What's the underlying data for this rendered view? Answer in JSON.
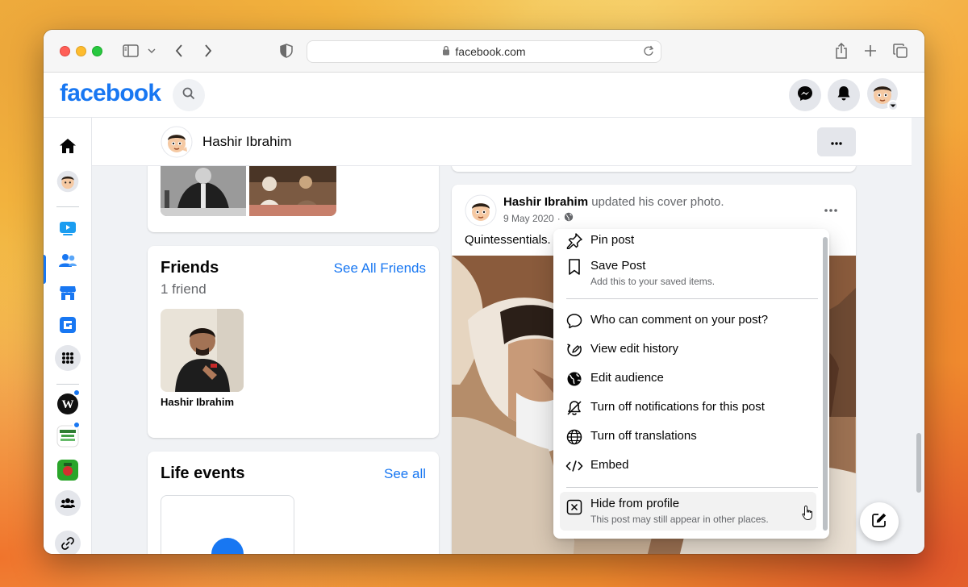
{
  "browser": {
    "url": "facebook.com"
  },
  "header": {
    "logo": "facebook"
  },
  "profile_bar": {
    "name": "Hashir Ibrahim"
  },
  "friends": {
    "title": "Friends",
    "see_all": "See All Friends",
    "count": "1 friend",
    "items": [
      {
        "name": "Hashir Ibrahim"
      }
    ]
  },
  "life_events": {
    "title": "Life events",
    "see_all": "See all"
  },
  "post": {
    "author": "Hashir Ibrahim",
    "action": "updated his cover photo.",
    "date": "9 May 2020",
    "separator": "·",
    "caption": "Quintessentials."
  },
  "menu": {
    "items": [
      {
        "label": "Pin post",
        "sub": "",
        "icon": "pin-icon"
      },
      {
        "label": "Save Post",
        "sub": "Add this to your saved items.",
        "icon": "bookmark-icon"
      },
      {
        "label": "Who can comment on your post?",
        "sub": "",
        "icon": "comment-icon"
      },
      {
        "label": "View edit history",
        "sub": "",
        "icon": "history-icon"
      },
      {
        "label": "Edit audience",
        "sub": "",
        "icon": "globe-icon"
      },
      {
        "label": "Turn off notifications for this post",
        "sub": "",
        "icon": "bell-off-icon"
      },
      {
        "label": "Turn off translations",
        "sub": "",
        "icon": "translate-icon"
      },
      {
        "label": "Embed",
        "sub": "",
        "icon": "code-icon"
      },
      {
        "label": "Hide from profile",
        "sub": "This post may still appear in other places.",
        "icon": "close-box-icon"
      }
    ]
  },
  "colors": {
    "brand": "#1877f2",
    "background": "#f0f2f5",
    "hover": "#f2f2f2"
  }
}
